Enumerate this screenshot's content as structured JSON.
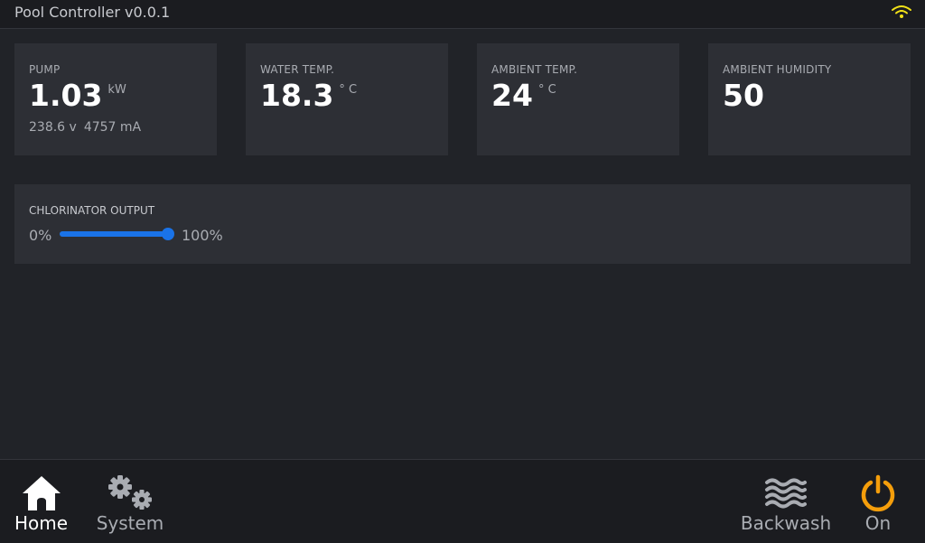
{
  "app": {
    "title": "Pool Controller v0.0.1",
    "wifi_icon": "wifi-icon",
    "wifi_color": "#f2e218"
  },
  "cards": [
    {
      "label": "PUMP",
      "value": "1.03",
      "unit": "kW",
      "sub_voltage": "238.6 v",
      "sub_current": "4757 mA"
    },
    {
      "label": "WATER TEMP.",
      "value": "18.3",
      "unit": "° C"
    },
    {
      "label": "AMBIENT TEMP.",
      "value": "24",
      "unit": "° C"
    },
    {
      "label": "AMBIENT HUMIDITY",
      "value": "50"
    }
  ],
  "chlorinator": {
    "label": "CHLORINATOR OUTPUT",
    "min_label": "0%",
    "max_label": "100%",
    "value_fraction": 1.0,
    "accent": "#1a73e8"
  },
  "nav": {
    "home": {
      "label": "Home",
      "icon": "home-icon"
    },
    "system": {
      "label": "System",
      "icon": "gears-icon"
    },
    "backwash": {
      "label": "Backwash",
      "icon": "waves-icon"
    },
    "power": {
      "label": "On",
      "icon": "power-icon",
      "color": "#f59e0b"
    }
  }
}
